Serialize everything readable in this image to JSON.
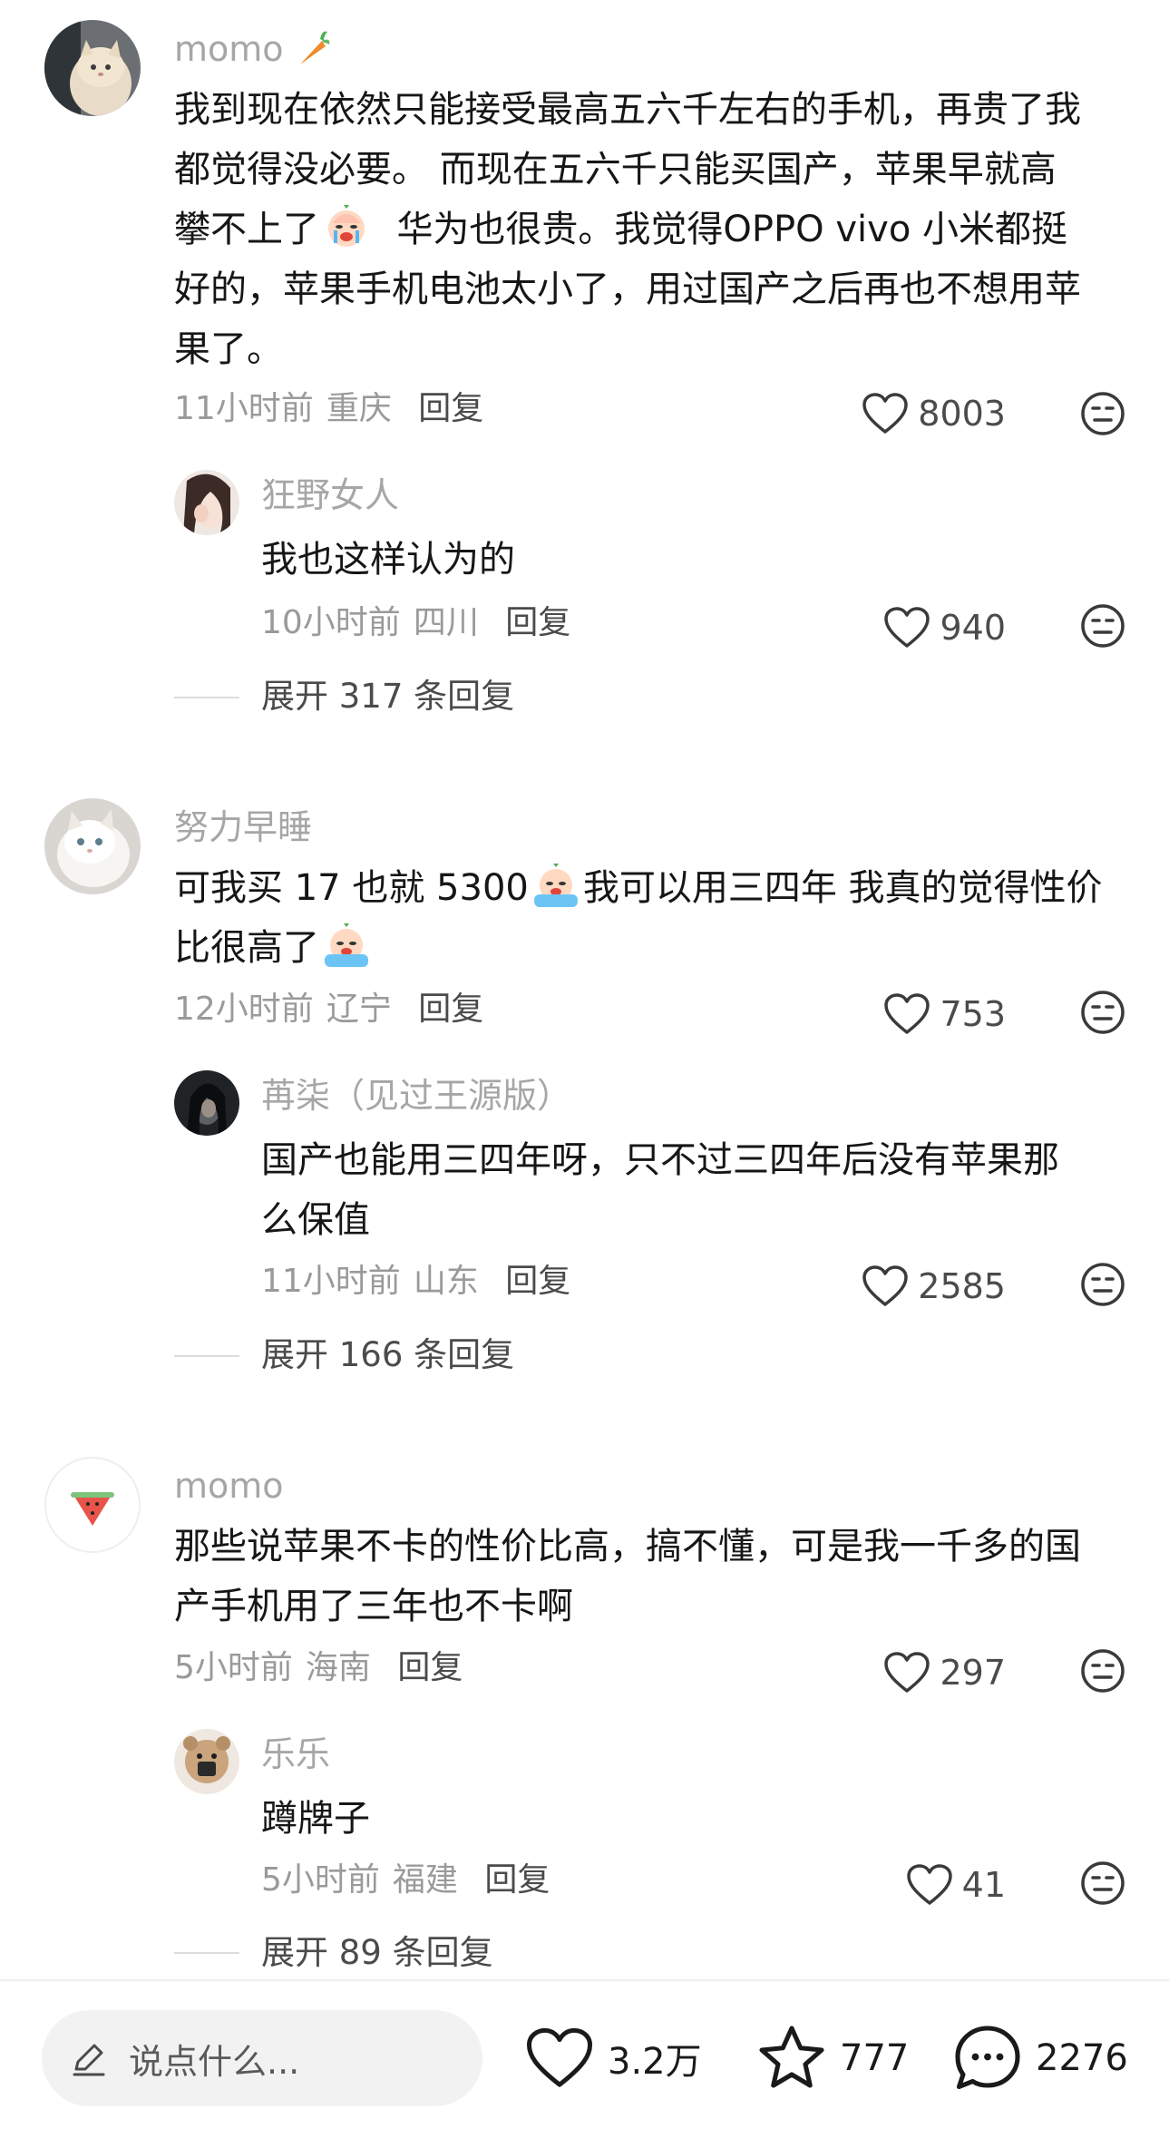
{
  "comments": [
    {
      "user": "momo",
      "user_emoji": "carrot-emoji",
      "text_parts": [
        "我到现在依然只能接受最高五六千左右的手机，再贵了我",
        "都觉得没必要。 而现在五六千只能买国产，苹果早就高",
        "攀不上了",
        "华为也很贵。我觉得OPPO vivo 小米都挺",
        "好的，苹果手机电池太小了，用过国产之后再也不想用苹",
        "果了。"
      ],
      "time": "11小时前",
      "location": "重庆",
      "reply_label": "回复",
      "likes": "8003",
      "reply": {
        "user": "狂野女人",
        "text": "我也这样认为的",
        "time": "10小时前",
        "location": "四川",
        "reply_label": "回复",
        "likes": "940"
      },
      "expand": "展开 317 条回复"
    },
    {
      "user": "努力早睡",
      "text_parts": [
        "可我买 17 也就 5300",
        "我可以用三四年 我真的觉得性价",
        "比很高了"
      ],
      "time": "12小时前",
      "location": "辽宁",
      "reply_label": "回复",
      "likes": "753",
      "reply": {
        "user": "苒柒（见过王源版）",
        "text_lines": [
          "国产也能用三四年呀，只不过三四年后没有苹果那",
          "么保值"
        ],
        "time": "11小时前",
        "location": "山东",
        "reply_label": "回复",
        "likes": "2585"
      },
      "expand": "展开 166 条回复"
    },
    {
      "user": "momo",
      "text_lines": [
        "那些说苹果不卡的性价比高，搞不懂，可是我一千多的国",
        "产手机用了三年也不卡啊"
      ],
      "time": "5小时前",
      "location": "海南",
      "reply_label": "回复",
      "likes": "297",
      "reply": {
        "user": "乐乐",
        "text": "蹲牌子",
        "time": "5小时前",
        "location": "福建",
        "reply_label": "回复",
        "likes": "41"
      },
      "expand": "展开 89 条回复"
    }
  ],
  "bottom_bar": {
    "placeholder": "说点什么...",
    "likes": "3.2万",
    "favorites": "777",
    "comments": "2276"
  },
  "colors": {
    "text": "#161616",
    "muted": "#9a9a9a",
    "icon": "#3a3a3a"
  }
}
